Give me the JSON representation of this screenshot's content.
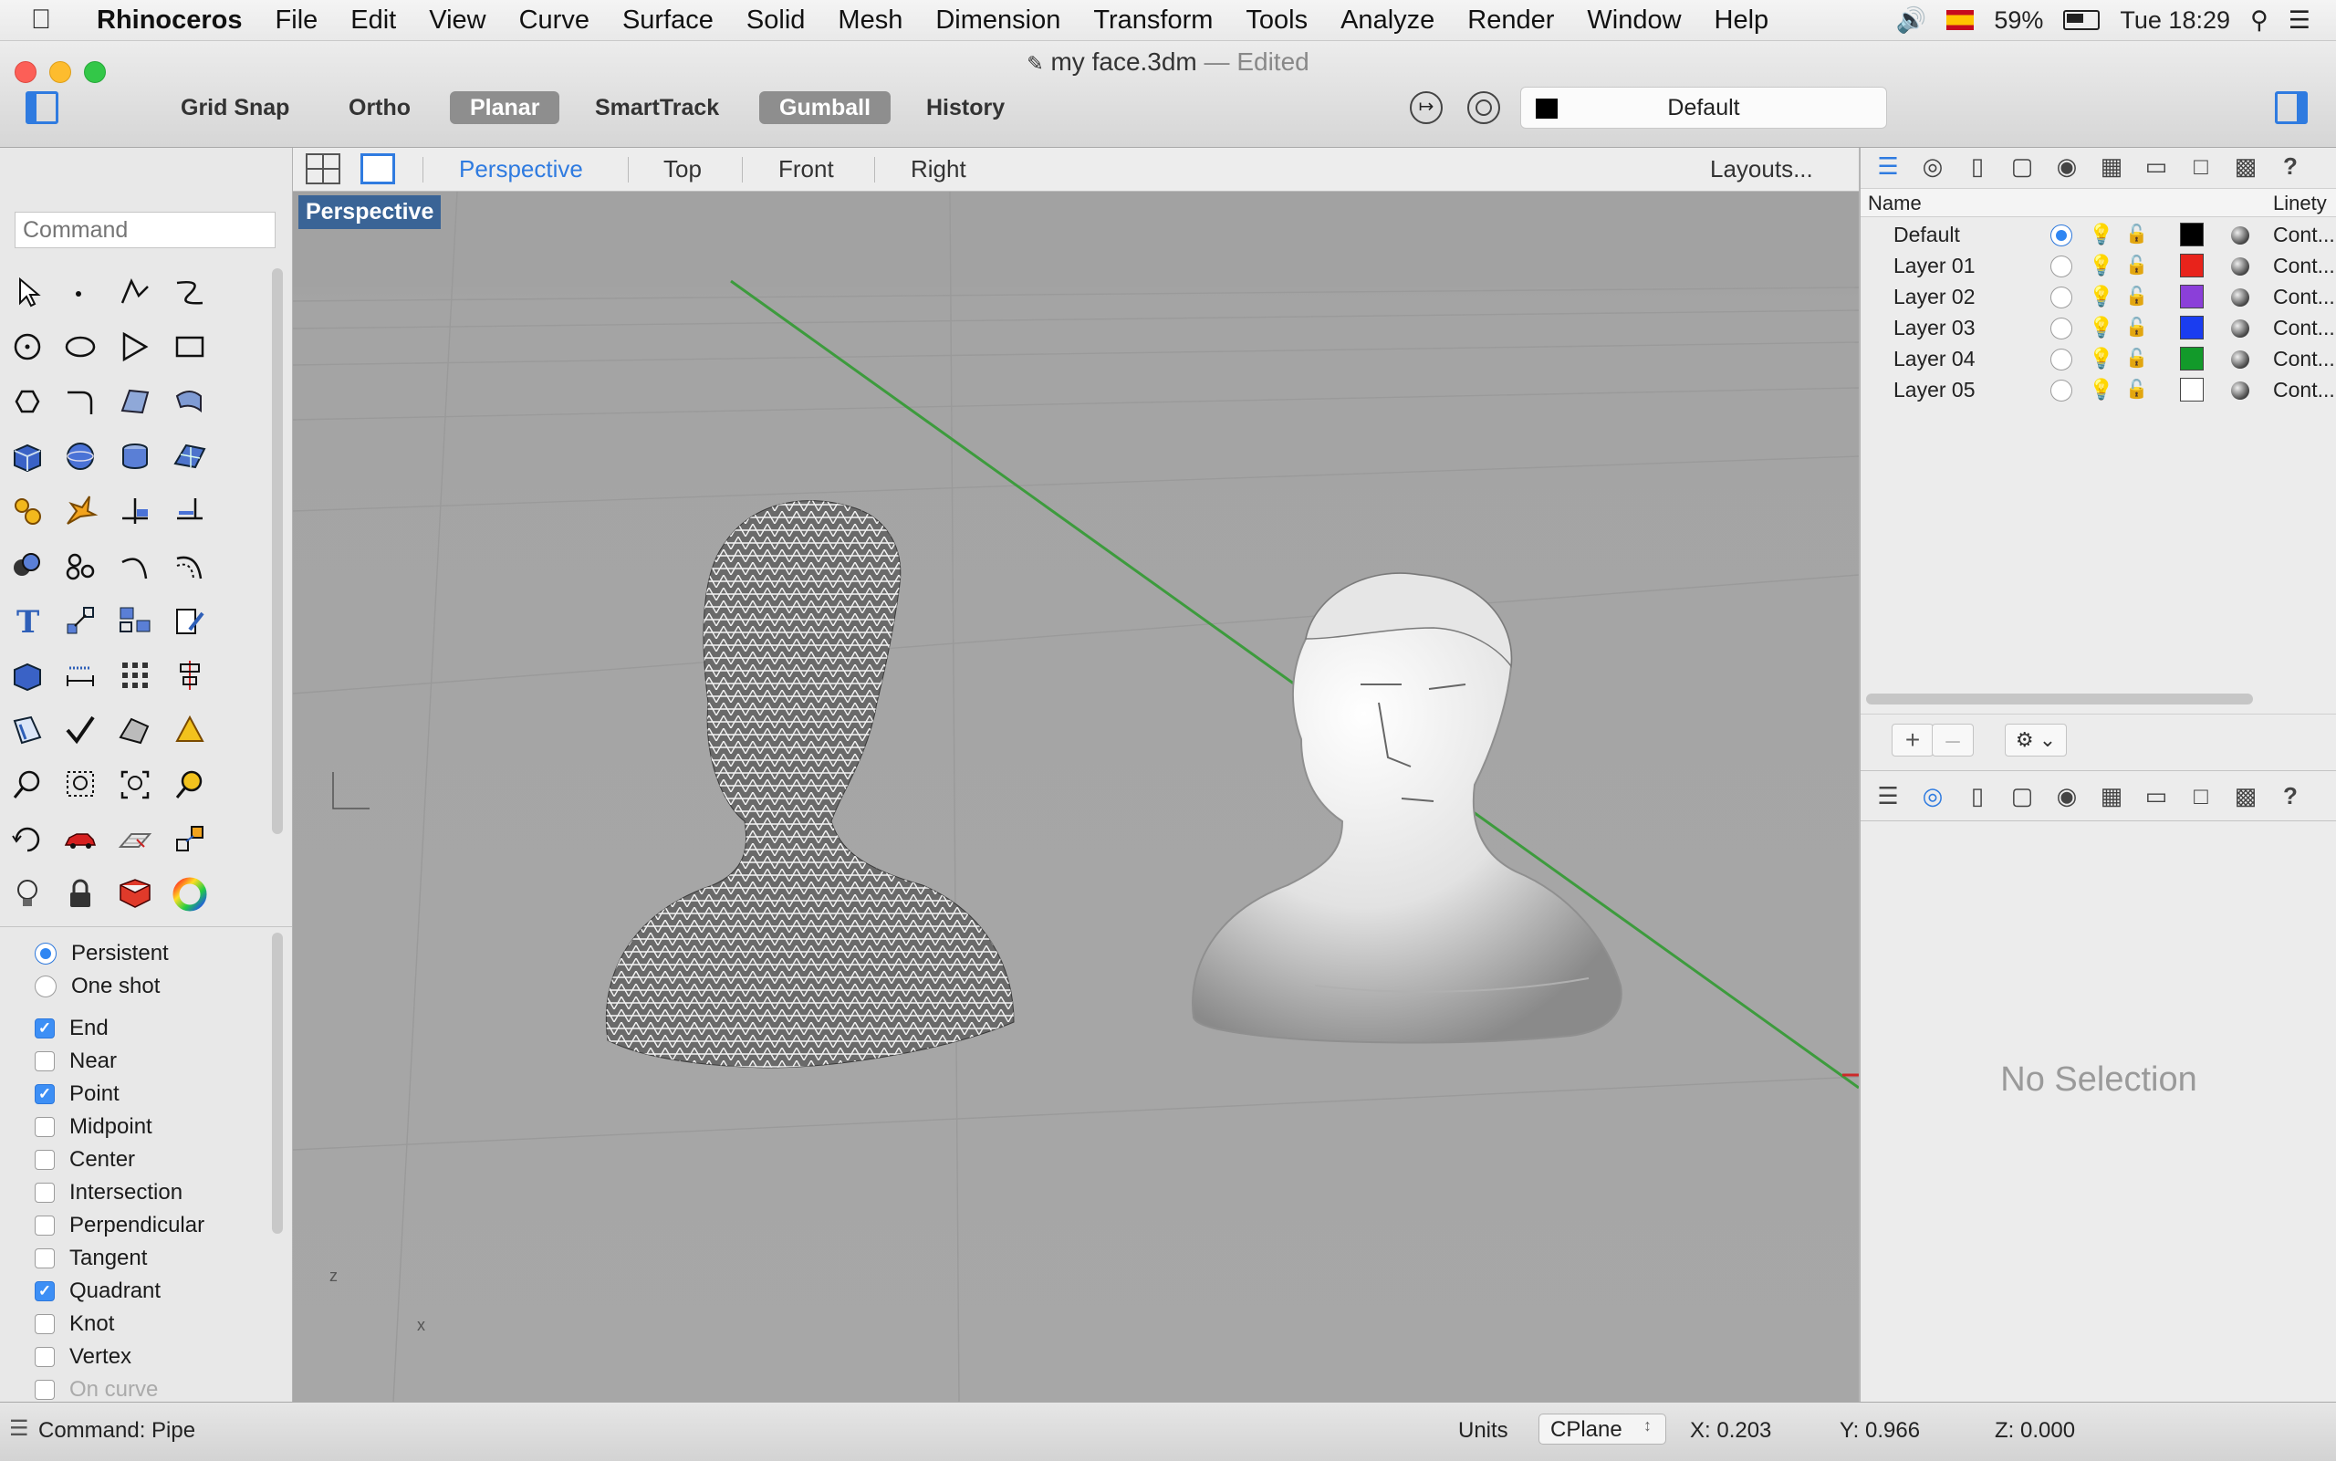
{
  "menubar": {
    "app_name": "Rhinoceros",
    "items": [
      "File",
      "Edit",
      "View",
      "Curve",
      "Surface",
      "Solid",
      "Mesh",
      "Dimension",
      "Transform",
      "Tools",
      "Analyze",
      "Render",
      "Window",
      "Help"
    ],
    "battery": "59%",
    "clock": "Tue 18:29"
  },
  "window": {
    "title": "my face.3dm",
    "edited": "— Edited"
  },
  "toolbar": {
    "grid_snap": "Grid Snap",
    "ortho": "Ortho",
    "planar": "Planar",
    "smarttrack": "SmartTrack",
    "gumball": "Gumball",
    "history": "History",
    "layer_combo": "Default"
  },
  "command": {
    "placeholder": "Command"
  },
  "osnap": {
    "mode_persistent": "Persistent",
    "mode_oneshot": "One shot",
    "items": [
      {
        "label": "End",
        "checked": true
      },
      {
        "label": "Near",
        "checked": false
      },
      {
        "label": "Point",
        "checked": true
      },
      {
        "label": "Midpoint",
        "checked": false
      },
      {
        "label": "Center",
        "checked": false
      },
      {
        "label": "Intersection",
        "checked": false
      },
      {
        "label": "Perpendicular",
        "checked": false
      },
      {
        "label": "Tangent",
        "checked": false
      },
      {
        "label": "Quadrant",
        "checked": true
      },
      {
        "label": "Knot",
        "checked": false
      },
      {
        "label": "Vertex",
        "checked": false
      },
      {
        "label": "On curve",
        "checked": false
      }
    ]
  },
  "viewport_tabs": {
    "perspective": "Perspective",
    "top": "Top",
    "front": "Front",
    "right": "Right",
    "layouts": "Layouts..."
  },
  "viewport": {
    "label": "Perspective",
    "axis_z": "z",
    "axis_x": "x"
  },
  "layers": {
    "col_name": "Name",
    "col_linetype": "Linety",
    "rows": [
      {
        "name": "Default",
        "color": "#000000",
        "current": true,
        "linetype": "Cont..."
      },
      {
        "name": "Layer 01",
        "color": "#e8231b",
        "current": false,
        "linetype": "Cont..."
      },
      {
        "name": "Layer 02",
        "color": "#8b3fd9",
        "current": false,
        "linetype": "Cont..."
      },
      {
        "name": "Layer 03",
        "color": "#1a3df0",
        "current": false,
        "linetype": "Cont..."
      },
      {
        "name": "Layer 04",
        "color": "#129a2a",
        "current": false,
        "linetype": "Cont..."
      },
      {
        "name": "Layer 05",
        "color": "#ffffff",
        "current": false,
        "linetype": "Cont..."
      }
    ]
  },
  "properties": {
    "empty": "No Selection"
  },
  "status": {
    "command_text": "Command: Pipe",
    "units": "Units",
    "cplane": "CPlane",
    "x": "X: 0.203",
    "y": "Y: 0.966",
    "z": "Z: 0.000"
  }
}
